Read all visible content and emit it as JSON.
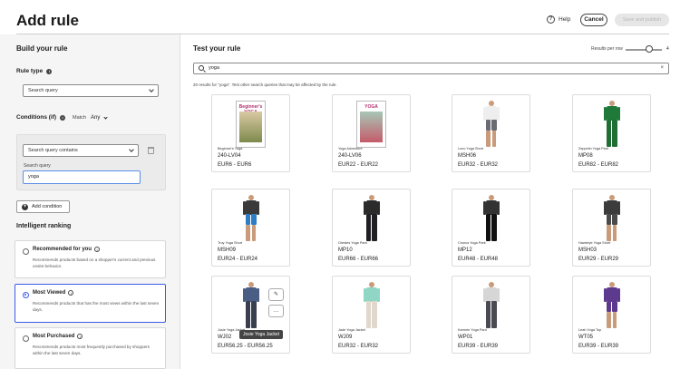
{
  "header": {
    "title": "Add rule",
    "help_label": "Help",
    "cancel_label": "Cancel",
    "save_label": "Save and publish"
  },
  "left": {
    "build_title": "Build your rule",
    "rule_type_label": "Rule type",
    "rule_type_value": "Search query",
    "conditions_label": "Conditions (if)",
    "match_label": "Match",
    "match_value": "Any",
    "condition_select": "Search query contains",
    "search_query_label": "Search query",
    "search_query_value": "yoga",
    "add_condition_label": "Add condition",
    "intelligent_ranking_title": "Intelligent ranking",
    "ranking_options": [
      {
        "title": "Recommended for you",
        "desc": "Recommends products based on a shopper's current and previous onsite behavior.",
        "selected": false
      },
      {
        "title": "Most Viewed",
        "desc": "Recommends products that has the most views within the last seven days.",
        "selected": true
      },
      {
        "title": "Most Purchased",
        "desc": "Recommends products most frequently purchased by shoppers within the last seven days.",
        "selected": false
      }
    ]
  },
  "right": {
    "title": "Test your rule",
    "results_per_row_label": "Results per row",
    "results_per_row_value": "4",
    "search_value": "yoga",
    "results_note": "20 results for \"yoga\". Test other search queries that may be affected by the rule.",
    "products": [
      {
        "name": "Beginner's Yoga",
        "sku": "240-LV04",
        "price": "EUR6 - EUR6",
        "kind": "book",
        "book_title": "Beginner's YOGA",
        "colors": {
          "top": "#d9c9a3",
          "bottom": "#7d8a4c"
        }
      },
      {
        "name": "Yoga Adventure",
        "sku": "240-LV06",
        "price": "EUR22 - EUR22",
        "kind": "book",
        "book_title": "YOGA",
        "colors": {
          "top": "#a6c6b6",
          "bottom": "#c55b6a"
        }
      },
      {
        "name": "Lono Yoga Short",
        "sku": "MSH06",
        "price": "EUR32 - EUR32",
        "kind": "fig",
        "colors": {
          "top": "#eeeeee",
          "bottom": "#6b6b73"
        },
        "shorts": true
      },
      {
        "name": "Zeppelin Yoga Pant",
        "sku": "MP08",
        "price": "EUR82 - EUR82",
        "kind": "fig",
        "colors": {
          "top": "#1f7a3a",
          "bottom": "#1f6e34"
        },
        "shorts": false
      },
      {
        "name": "Troy Yoga Short",
        "sku": "MSH09",
        "price": "EUR24 - EUR24",
        "kind": "fig",
        "colors": {
          "top": "#3a3a3a",
          "bottom": "#2f7dc4"
        },
        "shorts": true
      },
      {
        "name": "Orestes Yoga Pant",
        "sku": "MP10",
        "price": "EUR66 - EUR66",
        "kind": "fig",
        "colors": {
          "top": "#2b2b2b",
          "bottom": "#1f1f24"
        },
        "shorts": false
      },
      {
        "name": "Cronus Yoga Pant",
        "sku": "MP12",
        "price": "EUR48 - EUR48",
        "kind": "fig",
        "colors": {
          "top": "#333333",
          "bottom": "#111111"
        },
        "shorts": false
      },
      {
        "name": "Hawkeye Yoga Short",
        "sku": "MSH03",
        "price": "EUR29 - EUR29",
        "kind": "fig",
        "colors": {
          "top": "#3c3c3c",
          "bottom": "#4b4b4b"
        },
        "shorts": true
      },
      {
        "name": "Josie Yoga Jacket",
        "sku": "WJ02",
        "price": "EUR56.25 - EUR56.25",
        "kind": "fig",
        "colors": {
          "top": "#4a5d85",
          "bottom": "#3a3f4f"
        },
        "shorts": false
      },
      {
        "name": "Jade Yoga Jacket",
        "sku": "WJ09",
        "price": "EUR32 - EUR32",
        "kind": "fig",
        "colors": {
          "top": "#8fd6c4",
          "bottom": "#e0d8cc"
        },
        "shorts": false
      },
      {
        "name": "Karmen Yoga Pant",
        "sku": "WP01",
        "price": "EUR39 - EUR39",
        "kind": "fig",
        "colors": {
          "top": "#d6d6d6",
          "bottom": "#4a4a52"
        },
        "shorts": false
      },
      {
        "name": "Leah Yoga Top",
        "sku": "WT05",
        "price": "EUR39 - EUR39",
        "kind": "fig",
        "colors": {
          "top": "#5d3a8e",
          "bottom": "#5d3a8e"
        },
        "shorts": true
      }
    ],
    "hover_pin_icon": "pin-icon",
    "hover_more_icon": "more-icon",
    "tooltip": "Josie Yoga Jacket"
  }
}
